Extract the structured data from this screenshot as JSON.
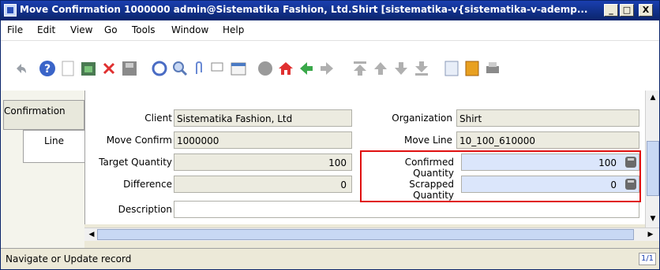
{
  "window": {
    "title": "Move Confirmation  1000000  admin@Sistematika Fashion, Ltd.Shirt [sistematika-v{sistematika-v-ademp...",
    "min_label": "_",
    "max_label": "□",
    "close_label": "X"
  },
  "menu": {
    "file": "File",
    "edit": "Edit",
    "view": "View",
    "go": "Go",
    "tools": "Tools",
    "window": "Window",
    "help": "Help"
  },
  "toolbar_icons": [
    "undo-icon",
    "help-icon",
    "new-record-icon",
    "copy-record-icon",
    "delete-icon",
    "save-icon",
    "refresh-icon",
    "find-icon",
    "attachment-icon",
    "chat-icon",
    "calendar-icon",
    "history-icon",
    "home-icon",
    "back-icon",
    "forward-icon",
    "first-record-icon",
    "previous-record-icon",
    "next-record-icon",
    "last-record-icon",
    "report-icon",
    "archive-icon",
    "print-icon"
  ],
  "tabs": {
    "confirmation": "Confirmation",
    "line": "Line"
  },
  "form": {
    "client_label": "Client",
    "client_value": "Sistematika Fashion, Ltd",
    "organization_label": "Organization",
    "organization_value": "Shirt",
    "move_confirm_label": "Move Confirm",
    "move_confirm_value": "1000000",
    "move_line_label": "Move Line",
    "move_line_value": "10_100_610000",
    "target_qty_label": "Target Quantity",
    "target_qty_value": "100",
    "confirmed_qty_label": "Confirmed Quantity",
    "confirmed_qty_value": "100",
    "difference_label": "Difference",
    "difference_value": "0",
    "scrapped_qty_label": "Scrapped Quantity",
    "scrapped_qty_value": "0",
    "description_label": "Description",
    "description_value": ""
  },
  "status": {
    "message": "Navigate or Update record",
    "record": "1/1"
  },
  "colors": {
    "title_bar": "#0a246a",
    "highlight_box": "#e01010",
    "editable_field": "#dbe6fb"
  }
}
